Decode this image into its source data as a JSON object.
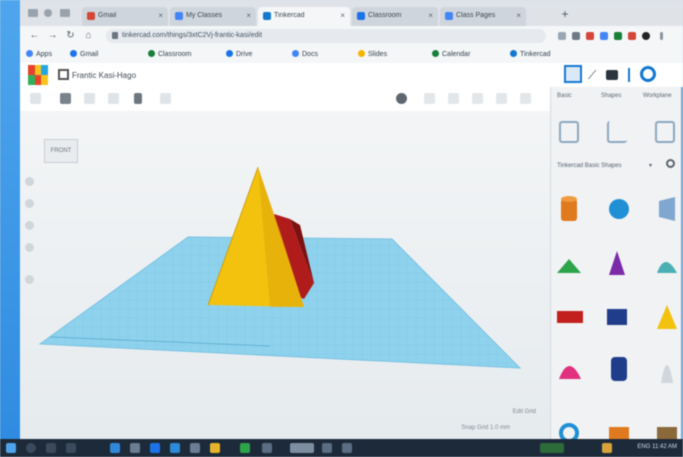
{
  "browser": {
    "tabs": [
      {
        "label": "Gmail",
        "color": "#d44638",
        "active": false
      },
      {
        "label": "My Classes",
        "color": "#4285f4",
        "active": false
      },
      {
        "label": "Tinkercad",
        "color": "#1477d1",
        "active": true
      },
      {
        "label": "Classroom",
        "color": "#1a73e8",
        "active": false
      },
      {
        "label": "Class Pages",
        "color": "#4285f4",
        "active": false
      }
    ],
    "new_tab": "+",
    "nav": {
      "back": "←",
      "forward": "→",
      "reload": "↻"
    },
    "url": "tinkercad.com/things/3xtC2Vj-frantic-kasi/edit",
    "bookmarks": [
      {
        "label": "Apps",
        "color": "#4285f4"
      },
      {
        "label": "Gmail",
        "color": "#1a73e8"
      },
      {
        "label": "Classroom",
        "color": "#188038"
      },
      {
        "label": "Drive",
        "color": "#1a73e8"
      },
      {
        "label": "Docs",
        "color": "#4285f4"
      },
      {
        "label": "Slides",
        "color": "#f4b400"
      },
      {
        "label": "Calendar",
        "color": "#188038"
      },
      {
        "label": "Tinkercad",
        "color": "#1477d1"
      }
    ]
  },
  "app": {
    "design_title": "Frantic Kasi-Hago",
    "panel_tabs": [
      "Basic",
      "Shapes",
      "Workplane"
    ],
    "shapes_category": "Tinkercad Basic Shapes",
    "dropdown_chevron": "▾",
    "view_cube_label": "FRONT",
    "zoom_label": "Edit Grid",
    "snap_label": "Snap Grid  1.0 mm"
  },
  "colors": {
    "accent": "#1477d1",
    "workplane": "#8fd2ee",
    "pyramid": "#f2c20e",
    "box": "#b01c1c"
  },
  "taskbar": {
    "tray": "ENG  11:42 AM"
  }
}
